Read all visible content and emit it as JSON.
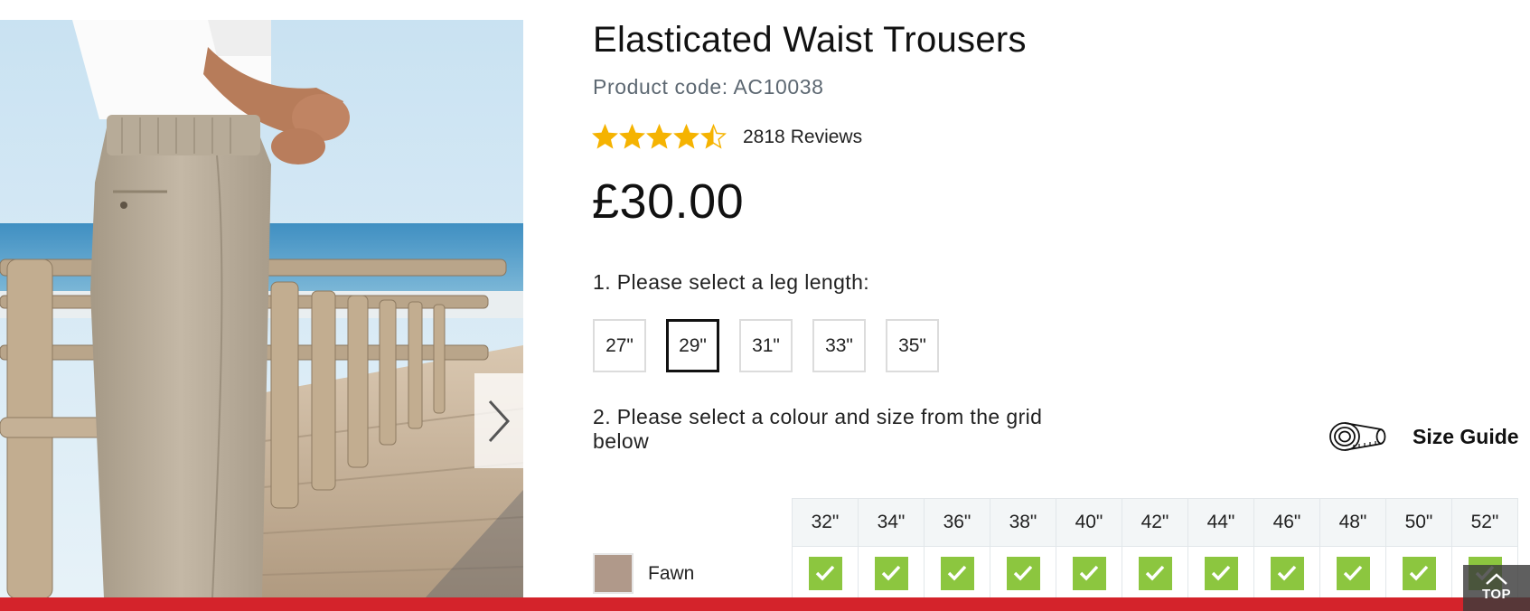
{
  "product": {
    "title": "Elasticated Waist Trousers",
    "code_label": "Product code:",
    "code": "AC10038",
    "rating": 4.5,
    "rating_max": 5,
    "review_count": "2818",
    "review_label": "Reviews",
    "price": "£30.00"
  },
  "gallery": {
    "image_alt": "Man in fawn elasticated waist trousers on a boardwalk by the sea",
    "next_icon": "chevron-right-icon"
  },
  "steps": {
    "leg_prompt": "1. Please select a leg length:",
    "grid_prompt": "2. Please select a colour and size from the grid below"
  },
  "leg_lengths": [
    "27\"",
    "29\"",
    "31\"",
    "33\"",
    "35\""
  ],
  "selected_leg": "29\"",
  "size_guide": {
    "label": "Size Guide",
    "icon": "tape-measure-icon"
  },
  "sizes": [
    "32\"",
    "34\"",
    "36\"",
    "38\"",
    "40\"",
    "42\"",
    "44\"",
    "46\"",
    "48\"",
    "50\"",
    "52\""
  ],
  "colours": [
    {
      "name": "Fawn",
      "swatch": "#b0998a",
      "available": [
        true,
        true,
        true,
        true,
        true,
        true,
        true,
        true,
        true,
        true,
        true
      ]
    }
  ],
  "top_button": {
    "label": "TOP"
  },
  "colors": {
    "accent_red": "#d4232b",
    "star": "#f5b301",
    "available_green": "#8cc63f",
    "code_grey": "#5d6872"
  }
}
